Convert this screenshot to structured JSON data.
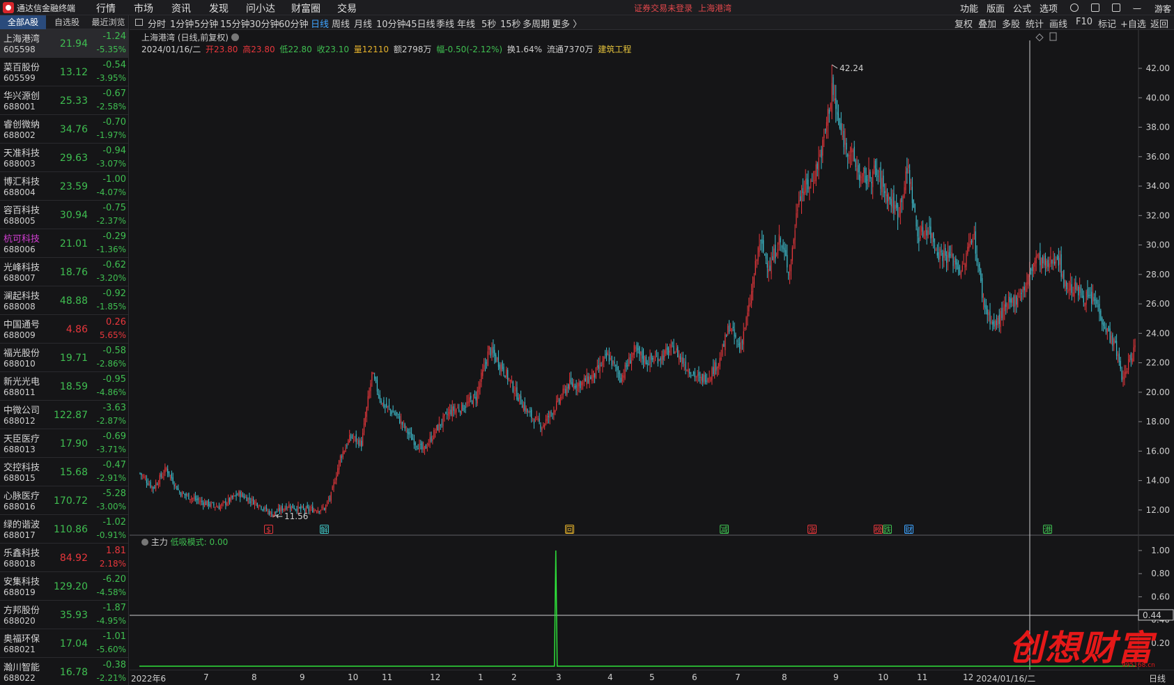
{
  "app": {
    "name": "通达信金融终端",
    "menus": [
      "行情",
      "市场",
      "资讯",
      "发现",
      "问小达",
      "财富圈",
      "交易"
    ],
    "status_warning": "证券交易未登录",
    "current_stock": "上海港湾",
    "right_menus": [
      "功能",
      "版面",
      "公式",
      "选项"
    ],
    "guest": "游客"
  },
  "sidebar": {
    "tabs": [
      "全部A股",
      "自选股",
      "最近浏览"
    ],
    "active_tab": 0,
    "stocks": [
      {
        "name": "上海港湾",
        "code": "605598",
        "price": "21.94",
        "change": "-1.24",
        "pct": "-5.35%",
        "dir": "dn",
        "selected": true
      },
      {
        "name": "菜百股份",
        "code": "605599",
        "price": "13.12",
        "change": "-0.54",
        "pct": "-3.95%",
        "dir": "dn"
      },
      {
        "name": "华兴源创",
        "code": "688001",
        "price": "25.33",
        "change": "-0.67",
        "pct": "-2.58%",
        "dir": "dn"
      },
      {
        "name": "睿创微纳",
        "code": "688002",
        "price": "34.76",
        "change": "-0.70",
        "pct": "-1.97%",
        "dir": "dn"
      },
      {
        "name": "天准科技",
        "code": "688003",
        "price": "29.63",
        "change": "-0.94",
        "pct": "-3.07%",
        "dir": "dn"
      },
      {
        "name": "博汇科技",
        "code": "688004",
        "price": "23.59",
        "change": "-1.00",
        "pct": "-4.07%",
        "dir": "dn"
      },
      {
        "name": "容百科技",
        "code": "688005",
        "price": "30.94",
        "change": "-0.75",
        "pct": "-2.37%",
        "dir": "dn"
      },
      {
        "name": "杭可科技",
        "code": "688006",
        "price": "21.01",
        "change": "-0.29",
        "pct": "-1.36%",
        "dir": "dn",
        "highlight": true
      },
      {
        "name": "光峰科技",
        "code": "688007",
        "price": "18.76",
        "change": "-0.62",
        "pct": "-3.20%",
        "dir": "dn"
      },
      {
        "name": "澜起科技",
        "code": "688008",
        "price": "48.88",
        "change": "-0.92",
        "pct": "-1.85%",
        "dir": "dn"
      },
      {
        "name": "中国通号",
        "code": "688009",
        "price": "4.86",
        "change": "0.26",
        "pct": "5.65%",
        "dir": "up"
      },
      {
        "name": "福光股份",
        "code": "688010",
        "price": "19.71",
        "change": "-0.58",
        "pct": "-2.86%",
        "dir": "dn"
      },
      {
        "name": "新光光电",
        "code": "688011",
        "price": "18.59",
        "change": "-0.95",
        "pct": "-4.86%",
        "dir": "dn"
      },
      {
        "name": "中微公司",
        "code": "688012",
        "price": "122.87",
        "change": "-3.63",
        "pct": "-2.87%",
        "dir": "dn"
      },
      {
        "name": "天臣医疗",
        "code": "688013",
        "price": "17.90",
        "change": "-0.69",
        "pct": "-3.71%",
        "dir": "dn"
      },
      {
        "name": "交控科技",
        "code": "688015",
        "price": "15.68",
        "change": "-0.47",
        "pct": "-2.91%",
        "dir": "dn"
      },
      {
        "name": "心脉医疗",
        "code": "688016",
        "price": "170.72",
        "change": "-5.28",
        "pct": "-3.00%",
        "dir": "dn"
      },
      {
        "name": "绿的谐波",
        "code": "688017",
        "price": "110.86",
        "change": "-1.02",
        "pct": "-0.91%",
        "dir": "dn"
      },
      {
        "name": "乐鑫科技",
        "code": "688018",
        "price": "84.92",
        "change": "1.81",
        "pct": "2.18%",
        "dir": "up"
      },
      {
        "name": "安集科技",
        "code": "688019",
        "price": "129.20",
        "change": "-6.20",
        "pct": "-4.58%",
        "dir": "dn"
      },
      {
        "name": "方邦股份",
        "code": "688020",
        "price": "35.93",
        "change": "-1.87",
        "pct": "-4.95%",
        "dir": "dn"
      },
      {
        "name": "奥福环保",
        "code": "688021",
        "price": "17.04",
        "change": "-1.01",
        "pct": "-5.60%",
        "dir": "dn"
      },
      {
        "name": "瀚川智能",
        "code": "688022",
        "price": "16.78",
        "change": "-0.38",
        "pct": "-2.21%",
        "dir": "dn"
      }
    ]
  },
  "toolbar": {
    "periods": [
      "分时",
      "1分钟",
      "5分钟",
      "15分钟",
      "30分钟",
      "60分钟",
      "日线",
      "周线",
      "月线",
      "10分钟",
      "45日线",
      "季线",
      "年线",
      "5秒",
      "15秒",
      "多周期",
      "更多 〉"
    ],
    "active_period": "日线",
    "right_tools": [
      "复权",
      "叠加",
      "多股",
      "统计",
      "画线",
      "F10",
      "标记",
      "+自选",
      "返回"
    ]
  },
  "header": {
    "title": "上海港湾 (日线,前复权)",
    "date": "2024/01/16/二",
    "open": "开23.80",
    "high": "高23.80",
    "low": "低22.80",
    "close": "收23.10",
    "volume": "量12110",
    "amount": "额2798万",
    "range": "幅-0.50(-2.12%)",
    "turnover": "换1.64%",
    "float": "流通7370万",
    "sector": "建筑工程"
  },
  "indicator": {
    "name": "主力",
    "label": "低吸模式: 0.00",
    "y_ticks": [
      "1.00",
      "0.80",
      "0.60",
      "0.40",
      "0.20"
    ],
    "cursor_value": "0.44"
  },
  "markers": [
    {
      "text": "$",
      "color": "#e8373c"
    },
    {
      "text": "解",
      "color": "#3fbfbf"
    },
    {
      "text": "回",
      "color": "#e6b32c"
    },
    {
      "text": "减",
      "color": "#3fbf51"
    },
    {
      "text": "涨",
      "color": "#e8373c"
    },
    {
      "text": "榜",
      "color": "#e8373c"
    },
    {
      "text": "跌",
      "color": "#3fbf51"
    },
    {
      "text": "财",
      "color": "#3fa4ff"
    },
    {
      "text": "港",
      "color": "#3fbf51"
    }
  ],
  "annotations": {
    "max_label": "42.24",
    "min_label": "11.56"
  },
  "x_axis": {
    "labels": [
      "2022年6",
      "7",
      "8",
      "9",
      "10",
      "11",
      "12",
      "1",
      "2",
      "3",
      "4",
      "5",
      "6",
      "7",
      "8",
      "9",
      "10",
      "11",
      "12",
      "2024/01/16/二"
    ],
    "right_label": "日线"
  },
  "watermark": {
    "text": "创想财富",
    "url": "995168.cn"
  },
  "chart_data": {
    "type": "candlestick",
    "title": "上海港湾 (日线,前复权)",
    "y_ticks": [
      12,
      14,
      16,
      18,
      20,
      22,
      24,
      26,
      28,
      30,
      32,
      34,
      36,
      38,
      40,
      42
    ],
    "ylim": [
      11.0,
      42.9
    ],
    "closing_trend": [
      [
        0,
        14.5
      ],
      [
        10,
        13.5
      ],
      [
        20,
        14.8
      ],
      [
        30,
        13.2
      ],
      [
        45,
        12.6
      ],
      [
        60,
        12.2
      ],
      [
        75,
        13.1
      ],
      [
        90,
        12.4
      ],
      [
        100,
        11.7
      ],
      [
        112,
        12.3
      ],
      [
        125,
        12.0
      ],
      [
        140,
        12.1
      ],
      [
        145,
        13.0
      ],
      [
        152,
        15.6
      ],
      [
        160,
        17.0
      ],
      [
        168,
        16.5
      ],
      [
        176,
        21.2
      ],
      [
        184,
        19.2
      ],
      [
        195,
        18.4
      ],
      [
        205,
        17.0
      ],
      [
        215,
        16.0
      ],
      [
        225,
        17.5
      ],
      [
        235,
        18.7
      ],
      [
        245,
        19.0
      ],
      [
        255,
        19.7
      ],
      [
        265,
        22.9
      ],
      [
        275,
        21.7
      ],
      [
        285,
        20.0
      ],
      [
        295,
        18.5
      ],
      [
        305,
        17.7
      ],
      [
        315,
        19.0
      ],
      [
        325,
        20.5
      ],
      [
        335,
        20.6
      ],
      [
        345,
        21.2
      ],
      [
        355,
        22.5
      ],
      [
        365,
        21.0
      ],
      [
        375,
        22.8
      ],
      [
        385,
        22.1
      ],
      [
        395,
        22.4
      ],
      [
        405,
        23.0
      ],
      [
        415,
        21.7
      ],
      [
        425,
        20.8
      ],
      [
        432,
        21.2
      ],
      [
        440,
        22.2
      ],
      [
        447,
        24.5
      ],
      [
        455,
        23.0
      ],
      [
        462,
        25.6
      ],
      [
        470,
        30.2
      ],
      [
        478,
        28.5
      ],
      [
        485,
        30.4
      ],
      [
        493,
        28.2
      ],
      [
        500,
        33.5
      ],
      [
        510,
        34.3
      ],
      [
        518,
        36.7
      ],
      [
        525,
        40.5
      ],
      [
        532,
        37.5
      ],
      [
        540,
        36.1
      ],
      [
        548,
        34.3
      ],
      [
        558,
        35.0
      ],
      [
        567,
        33.4
      ],
      [
        575,
        32.2
      ],
      [
        583,
        35.2
      ],
      [
        590,
        30.6
      ],
      [
        598,
        31.2
      ],
      [
        606,
        29.5
      ],
      [
        615,
        29.2
      ],
      [
        624,
        28.2
      ],
      [
        632,
        31.0
      ],
      [
        640,
        26.1
      ],
      [
        648,
        24.4
      ],
      [
        656,
        25.6
      ],
      [
        664,
        26.3
      ],
      [
        672,
        27.2
      ],
      [
        680,
        29.2
      ],
      [
        688,
        28.5
      ],
      [
        696,
        29.4
      ],
      [
        702,
        27.2
      ],
      [
        710,
        27.0
      ],
      [
        718,
        26.4
      ],
      [
        725,
        26.2
      ],
      [
        733,
        24.3
      ],
      [
        740,
        23.1
      ],
      [
        746,
        20.8
      ],
      [
        750,
        22.0
      ],
      [
        755,
        23.1
      ]
    ],
    "max": 42.24,
    "min": 11.56,
    "indicator_spike_index": 316,
    "indicator_spike_value": 1.0
  }
}
